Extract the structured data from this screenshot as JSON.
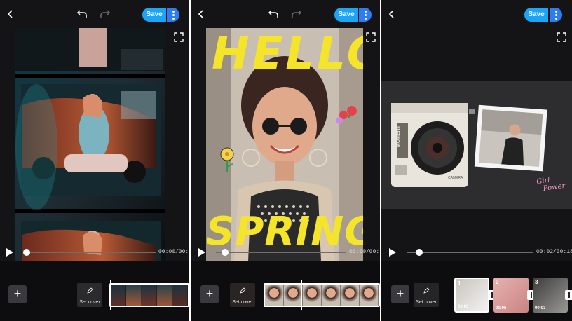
{
  "common": {
    "save_label": "Save",
    "set_cover_label": "Set cover",
    "add_symbol": "+"
  },
  "screen1": {
    "time": "00:00/00:13",
    "progress": 0.0
  },
  "screen2": {
    "time": "00:00/00:31",
    "progress": 0.06,
    "text_top": "HELLO",
    "text_bottom": "SPRING"
  },
  "screen3": {
    "time": "00:02/00:18",
    "progress": 0.11,
    "camera_brand": "MOMENT",
    "camera_tag": "CAMERA",
    "sticker_line1": "Girl",
    "sticker_line2": "Power",
    "clips": [
      {
        "num": "1",
        "dur": "00:05"
      },
      {
        "num": "2",
        "dur": "00:05"
      },
      {
        "num": "3",
        "dur": "00:03"
      }
    ]
  },
  "colors": {
    "accent": "#19a6f7",
    "accent2": "#2f7cf0",
    "panel_bg": "#141416",
    "text_yellow": "#f4e52a"
  }
}
